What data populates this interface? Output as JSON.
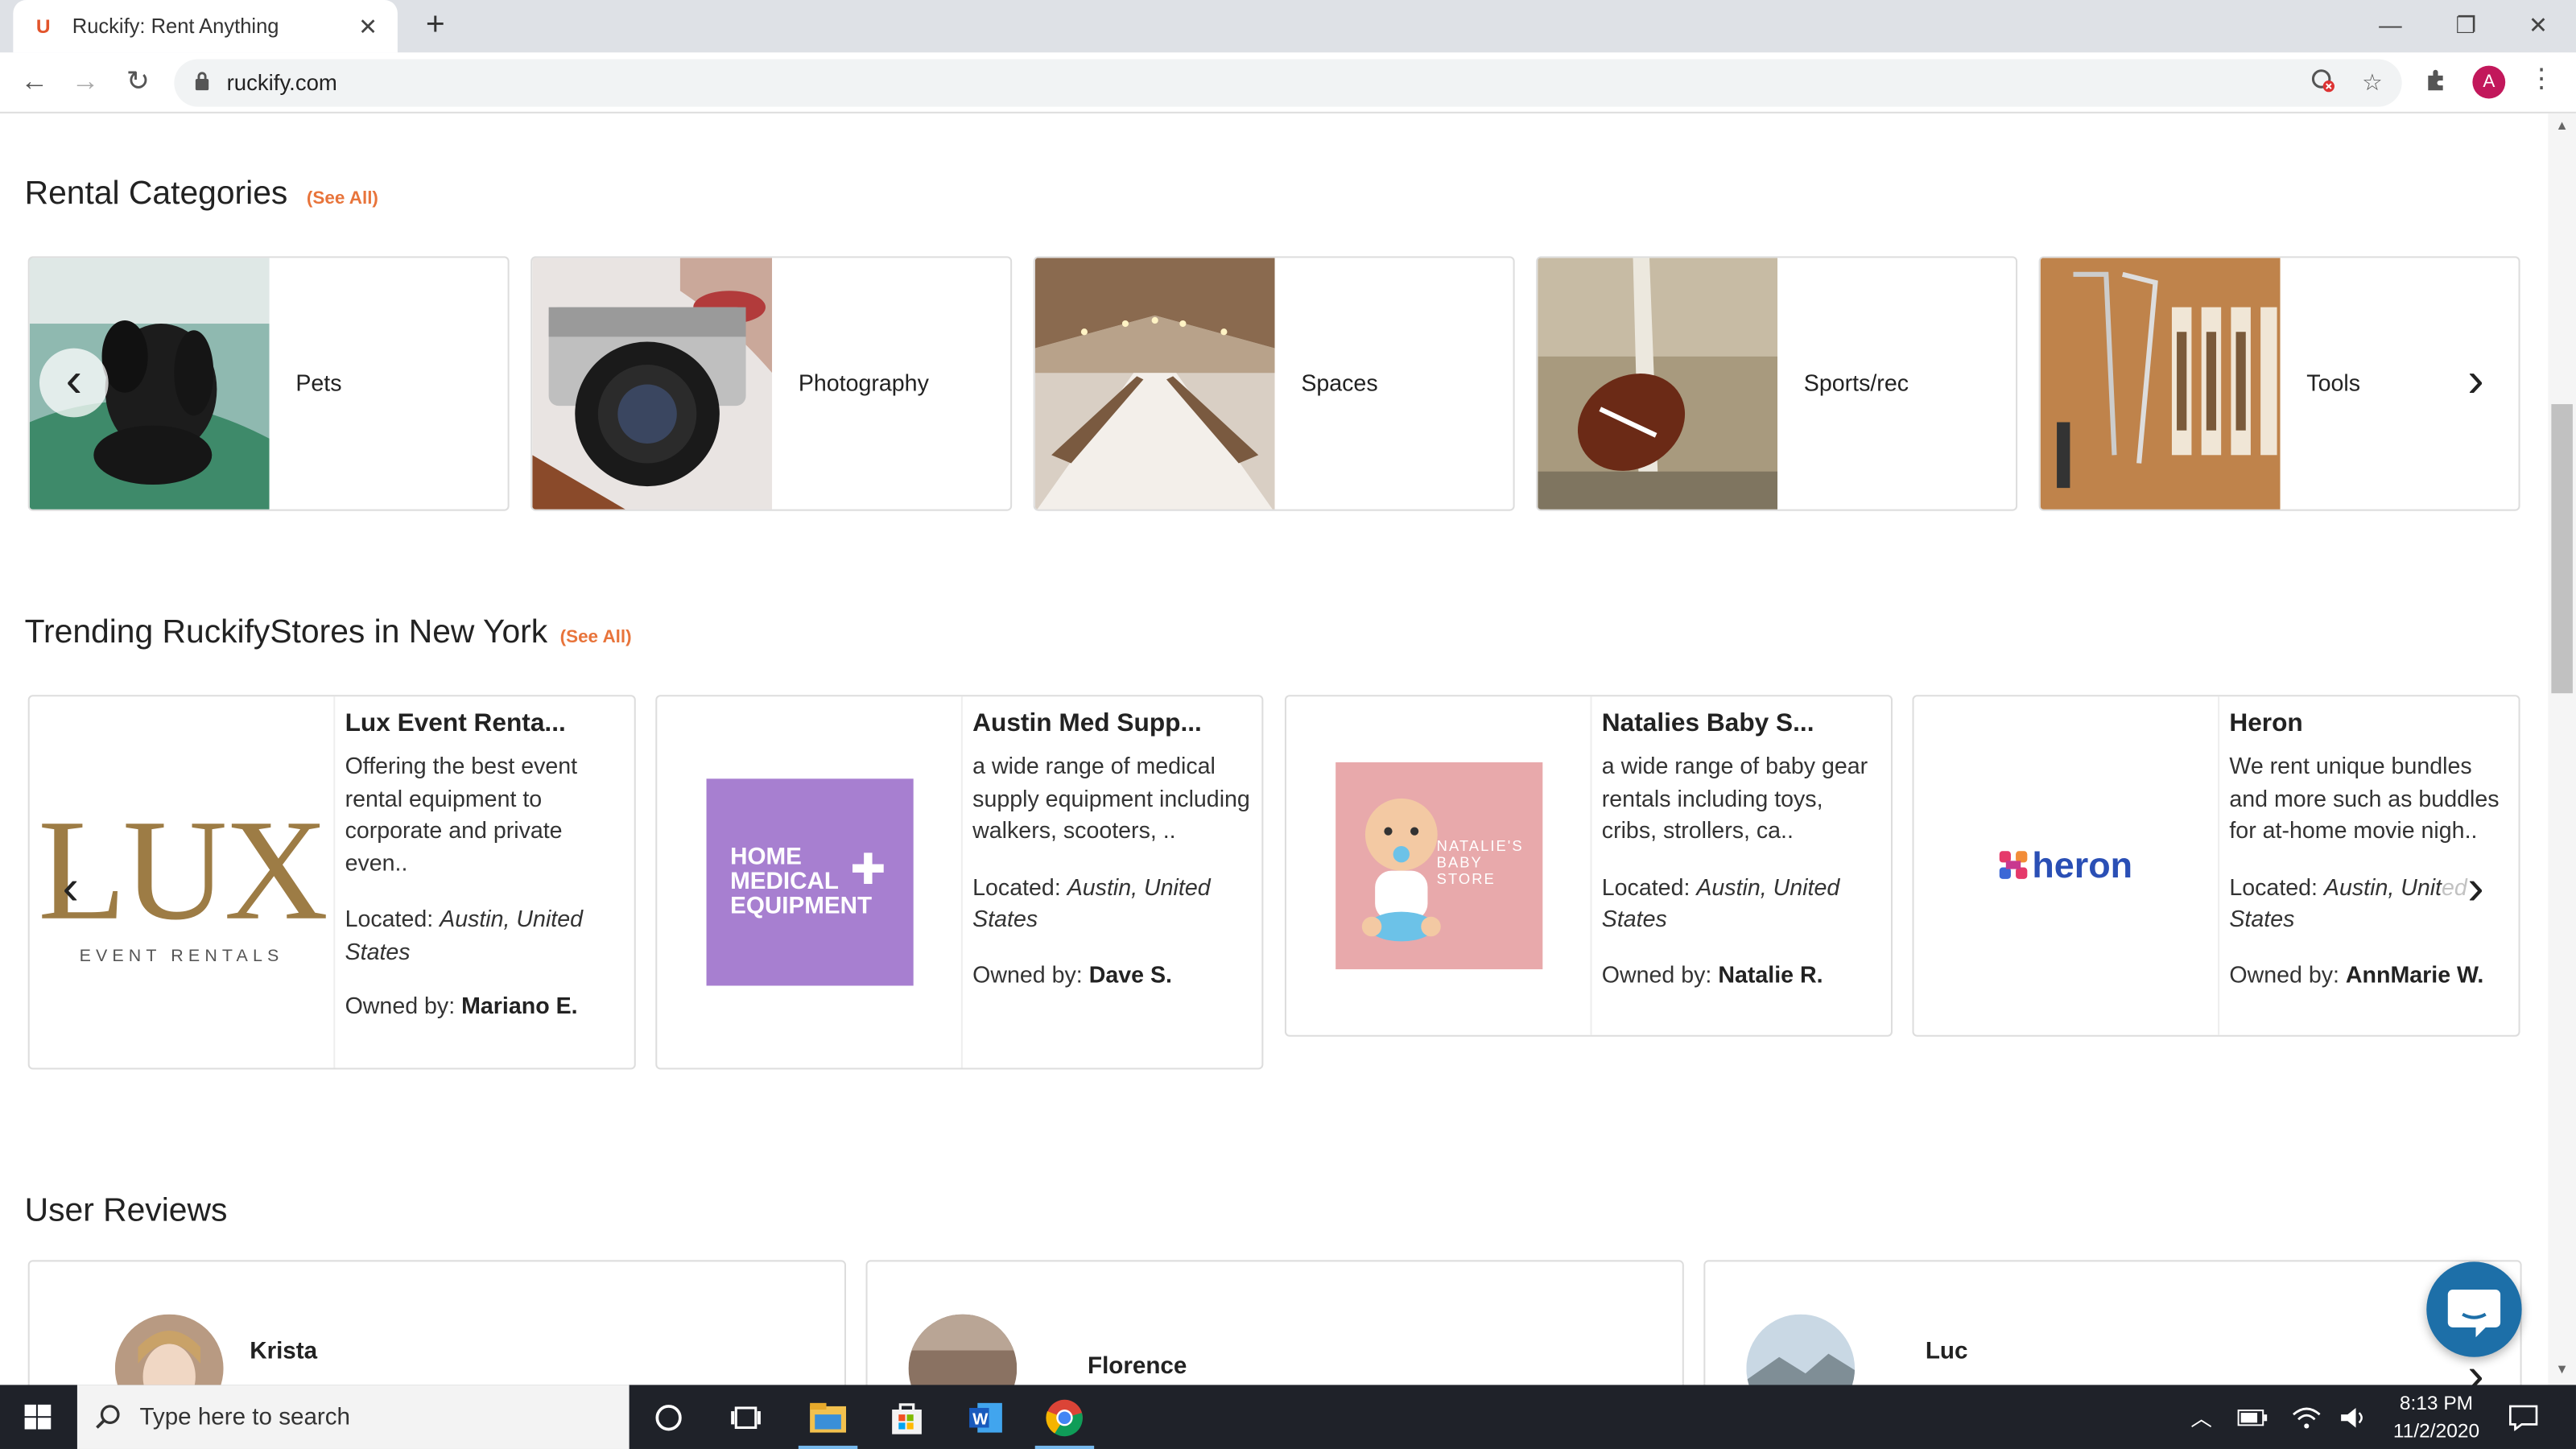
{
  "browser": {
    "tab_title": "Ruckify: Rent Anything",
    "favicon_letter": "U",
    "url": "ruckify.com",
    "profile_initial": "A"
  },
  "page": {
    "categories": {
      "title": "Rental Categories",
      "see_all": "(See All)",
      "items": [
        {
          "label": "Pets"
        },
        {
          "label": "Photography"
        },
        {
          "label": "Spaces"
        },
        {
          "label": "Sports/rec"
        },
        {
          "label": "Tools"
        }
      ]
    },
    "stores": {
      "title": "Trending RuckifyStores in New York",
      "see_all": "(See All)",
      "items": [
        {
          "name": "Lux Event Renta...",
          "description": "Offering the best event rental equipment to corporate and private even..",
          "located_label": "Located:",
          "location": "Austin, United States",
          "owned_label": "Owned by:",
          "owner": "Mariano E.",
          "logo_text": "LUX",
          "logo_sub": "EVENT RENTALS"
        },
        {
          "name": "Austin Med Supp...",
          "description": "a wide range of medical supply equipment including walkers, scooters, ..",
          "located_label": "Located:",
          "location": "Austin, United States",
          "owned_label": "Owned by:",
          "owner": "Dave S.",
          "logo_text": "HOME MEDICAL EQUIPMENT"
        },
        {
          "name": "Natalies Baby S...",
          "description": "a wide range of baby gear rentals including toys, cribs, strollers, ca..",
          "located_label": "Located:",
          "location": "Austin, United States",
          "owned_label": "Owned by:",
          "owner": "Natalie R.",
          "logo_text": "NATALIE'S BABY STORE"
        },
        {
          "name": "Heron",
          "description": "We rent unique bundles and more such as buddles for at-home movie nigh..",
          "located_label": "Located:",
          "location": "Austin, United States",
          "owned_label": "Owned by:",
          "owner": "AnnMarie W.",
          "logo_text": "heron"
        }
      ]
    },
    "reviews": {
      "title": "User Reviews",
      "items": [
        {
          "name": "Krista"
        },
        {
          "name": "Florence"
        },
        {
          "name": "Luc"
        }
      ]
    }
  },
  "taskbar": {
    "search_placeholder": "Type here to search",
    "time": "8:13 PM",
    "date": "11/2/2020"
  },
  "colors": {
    "accent": "#e8743b",
    "chat": "#1d6fa8",
    "taskbar": "#1f2229",
    "med_logo": "#a77fd0",
    "baby_logo": "#e8a9ab"
  }
}
